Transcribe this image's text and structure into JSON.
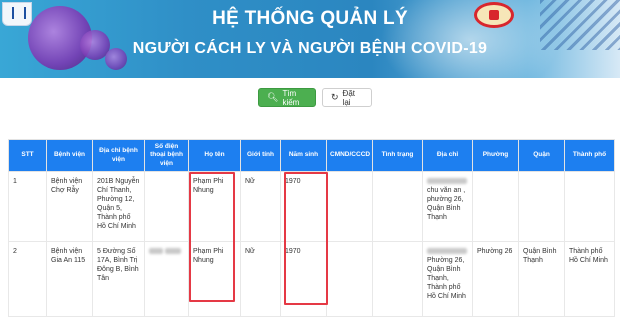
{
  "header": {
    "title_line1": "HỆ THỐNG QUẢN LÝ",
    "title_line2": "NGƯỜI CÁCH LY VÀ NGƯỜI BỆNH COVID-19"
  },
  "actions": {
    "search_label": "Tìm kiếm",
    "reset_label": "Đặt lại"
  },
  "table": {
    "columns": [
      "STT",
      "Bệnh viện",
      "Địa chỉ bệnh viện",
      "Số điện thoại bệnh viện",
      "Họ tên",
      "Giới tính",
      "Năm sinh",
      "CMND/CCCD",
      "Tình trạng",
      "Địa chỉ",
      "Phường",
      "Quận",
      "Thành phố"
    ],
    "rows": [
      {
        "stt": "1",
        "hospital": "Bệnh viện Chợ Rẫy",
        "hospital_address": "201B Nguyễn Chí Thanh, Phường 12, Quận 5, Thành phố Hồ Chí Minh",
        "hospital_phone": "",
        "name": "Phạm Phi Nhung",
        "gender": "Nữ",
        "birth_year": "1970",
        "id_number": "",
        "status": "",
        "address": "chu văn an , phường 26, Quận Bình Thạnh",
        "ward": "",
        "district": "",
        "city": ""
      },
      {
        "stt": "2",
        "hospital": "Bệnh viện Gia An 115",
        "hospital_address": "5 Đường Số 17A, Bình Trị Đông B, Bình Tân",
        "hospital_phone": "",
        "name": "Phạm Phi Nhung",
        "gender": "Nữ",
        "birth_year": "1970",
        "id_number": "",
        "status": "",
        "address": "Phường 26, Quận Bình Thạnh, Thành phố Hồ Chí Minh",
        "ward": "Phường 26",
        "district": "Quận Bình Thạnh",
        "city": "Thành phố Hồ Chí Minh"
      }
    ]
  },
  "colors": {
    "header_bg": "#1d7ff0",
    "search_button": "#4caf50",
    "highlight_box": "#e53945"
  },
  "icons": {
    "search_button_icon": "search-icon",
    "reset_button_icon": "refresh-icon"
  }
}
